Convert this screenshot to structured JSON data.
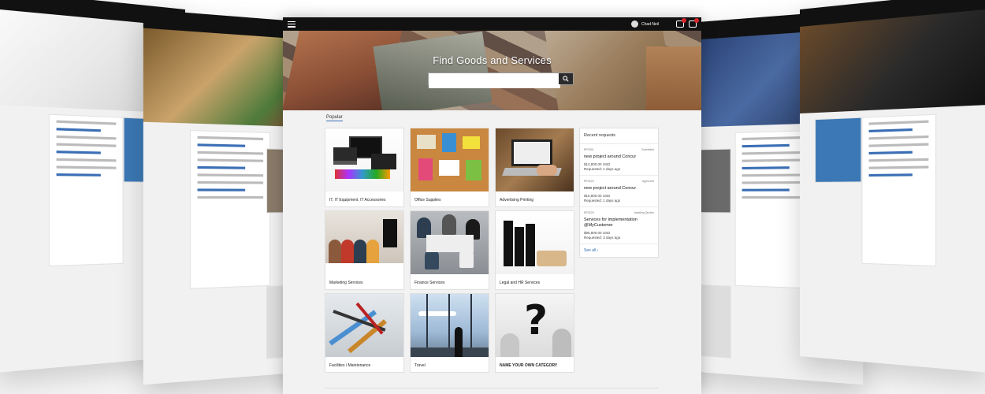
{
  "topbar": {
    "user_name": "Chad Neil"
  },
  "hero": {
    "title": "Find Goods and Services",
    "search_placeholder": ""
  },
  "section": {
    "popular_label": "Popular"
  },
  "categories": [
    {
      "label": "IT, IT Equipment, IT Accessories"
    },
    {
      "label": "Office Supplies"
    },
    {
      "label": "Advertising Printing"
    },
    {
      "label": "Marketing Services"
    },
    {
      "label": "Finance Services"
    },
    {
      "label": "Legal and HR Services"
    },
    {
      "label": "Facilities / Maintenance"
    },
    {
      "label": "Travel"
    },
    {
      "label": "NAME YOUR OWN CATEGORY"
    }
  ],
  "requests": {
    "heading": "Recent requests",
    "items": [
      {
        "id": "RP3091",
        "status": "Submitted",
        "title": "new project around Concur",
        "amount": "$14,800.00 USD",
        "time": "Requested: 1 days ago"
      },
      {
        "id": "RP3224",
        "status": "Approved",
        "title": "new project around Concur",
        "amount": "$15,800.00 USD",
        "time": "Requested: 1 days ago"
      },
      {
        "id": "RP3225",
        "status": "Awaiting Quotes",
        "title": "Services for implementation @MyCustomer",
        "amount": "$95,800.00 USD",
        "time": "Requested: 3 days ago"
      }
    ],
    "see_all": "See all ›"
  },
  "colors": {
    "topbar": "#111111",
    "accent": "#3b6fb5",
    "badge": "#d9262c",
    "page_bg": "#f2f2f2"
  }
}
